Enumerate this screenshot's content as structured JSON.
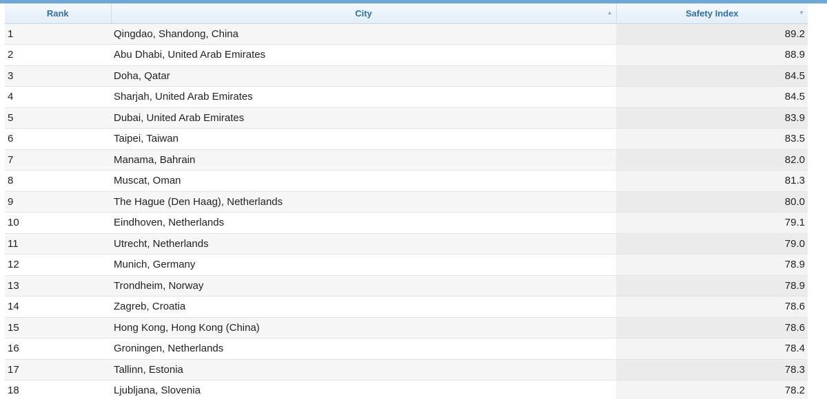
{
  "table": {
    "columns": [
      {
        "label": "Rank",
        "sort": ""
      },
      {
        "label": "City",
        "sort": "▲"
      },
      {
        "label": "Safety Index",
        "sort": "▼"
      }
    ],
    "rows": [
      {
        "rank": "1",
        "city": "Qingdao, Shandong, China",
        "safety_index": "89.2"
      },
      {
        "rank": "2",
        "city": "Abu Dhabi, United Arab Emirates",
        "safety_index": "88.9"
      },
      {
        "rank": "3",
        "city": "Doha, Qatar",
        "safety_index": "84.5"
      },
      {
        "rank": "4",
        "city": "Sharjah, United Arab Emirates",
        "safety_index": "84.5"
      },
      {
        "rank": "5",
        "city": "Dubai, United Arab Emirates",
        "safety_index": "83.9"
      },
      {
        "rank": "6",
        "city": "Taipei, Taiwan",
        "safety_index": "83.5"
      },
      {
        "rank": "7",
        "city": "Manama, Bahrain",
        "safety_index": "82.0"
      },
      {
        "rank": "8",
        "city": "Muscat, Oman",
        "safety_index": "81.3"
      },
      {
        "rank": "9",
        "city": "The Hague (Den Haag), Netherlands",
        "safety_index": "80.0"
      },
      {
        "rank": "10",
        "city": "Eindhoven, Netherlands",
        "safety_index": "79.1"
      },
      {
        "rank": "11",
        "city": "Utrecht, Netherlands",
        "safety_index": "79.0"
      },
      {
        "rank": "12",
        "city": "Munich, Germany",
        "safety_index": "78.9"
      },
      {
        "rank": "13",
        "city": "Trondheim, Norway",
        "safety_index": "78.9"
      },
      {
        "rank": "14",
        "city": "Zagreb, Croatia",
        "safety_index": "78.6"
      },
      {
        "rank": "15",
        "city": "Hong Kong, Hong Kong (China)",
        "safety_index": "78.6"
      },
      {
        "rank": "16",
        "city": "Groningen, Netherlands",
        "safety_index": "78.4"
      },
      {
        "rank": "17",
        "city": "Tallinn, Estonia",
        "safety_index": "78.3"
      },
      {
        "rank": "18",
        "city": "Ljubljana, Slovenia",
        "safety_index": "78.2"
      }
    ]
  },
  "colors": {
    "header_text": "#2f6fa6",
    "top_bar": "#6fa8d6",
    "row_odd": "#f7f7f7",
    "row_even": "#ffffff",
    "sorted_column": "#ececec"
  }
}
